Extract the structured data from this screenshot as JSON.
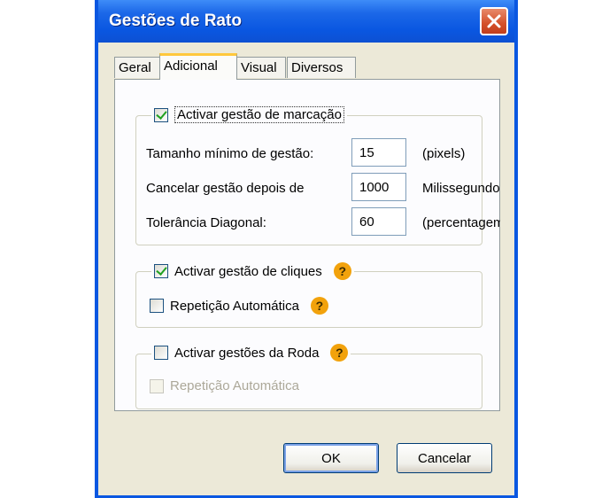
{
  "window": {
    "title": "Gestões de Rato"
  },
  "tabs": [
    {
      "label": "Geral",
      "active": false
    },
    {
      "label": "Adicional",
      "active": true
    },
    {
      "label": "Visual",
      "active": false
    },
    {
      "label": "Diversos",
      "active": false
    }
  ],
  "marking_group": {
    "checkbox_label": "Activar gestão de marcação",
    "checked": true,
    "rows": [
      {
        "label": "Tamanho mínimo de gestão:",
        "value": "15",
        "unit": "(pixels)"
      },
      {
        "label": "Cancelar gestão depois de",
        "value": "1000",
        "unit": "Milissegundos"
      },
      {
        "label": "Tolerância Diagonal:",
        "value": "60",
        "unit": "(percentagem"
      }
    ]
  },
  "click_group": {
    "checkbox_label": "Activar gestão de cliques",
    "checked": true,
    "auto_repeat_label": "Repetição Automática",
    "auto_repeat_checked": false
  },
  "wheel_group": {
    "checkbox_label": "Activar gestões da Roda",
    "checked": false,
    "auto_repeat_label": "Repetição Automática",
    "auto_repeat_checked": false,
    "auto_repeat_disabled": true
  },
  "help_glyph": "?",
  "buttons": {
    "ok": "OK",
    "cancel": "Cancelar"
  },
  "colors": {
    "titlebar": "#0A57E1",
    "client": "#ECE9D8",
    "help": "#F2A20C",
    "active_tab_accent": "#FFC83C"
  }
}
